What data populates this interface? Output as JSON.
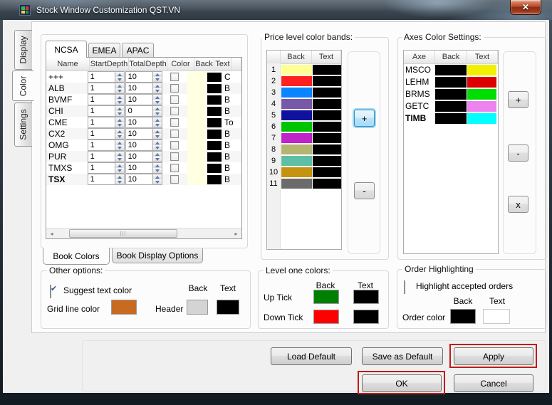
{
  "window": {
    "title": "Stock Window Customization QST.VN",
    "close_glyph": "✕"
  },
  "side_tabs": [
    {
      "label": "Display",
      "selected": false
    },
    {
      "label": "Color",
      "selected": true
    },
    {
      "label": "Settings",
      "selected": false
    }
  ],
  "book": {
    "region_tabs": [
      "NCSA",
      "EMEA",
      "APAC"
    ],
    "selected_region": "NCSA",
    "headers": [
      "Name",
      "StartDepth",
      "TotalDepth",
      "Color",
      "Back",
      "Text"
    ],
    "rows": [
      {
        "name": "+++",
        "start": "1",
        "total": "10",
        "back": "#FFFFE1",
        "text": "#000000",
        "next": "C"
      },
      {
        "name": "ALB",
        "start": "1",
        "total": "10",
        "back": "#FFFFE1",
        "text": "#000000",
        "next": "B"
      },
      {
        "name": "BVMF",
        "start": "1",
        "total": "10",
        "back": "#FFFFE1",
        "text": "#000000",
        "next": "B"
      },
      {
        "name": "CHI",
        "start": "1",
        "total": "0",
        "back": "#FFFFE1",
        "text": "#000000",
        "next": "B"
      },
      {
        "name": "CME",
        "start": "1",
        "total": "10",
        "back": "#FFFFE1",
        "text": "#000000",
        "next": "To"
      },
      {
        "name": "CX2",
        "start": "1",
        "total": "10",
        "back": "#FFFFE1",
        "text": "#000000",
        "next": "B"
      },
      {
        "name": "OMG",
        "start": "1",
        "total": "10",
        "back": "#FFFFE1",
        "text": "#000000",
        "next": "B"
      },
      {
        "name": "PUR",
        "start": "1",
        "total": "10",
        "back": "#FFFFE1",
        "text": "#000000",
        "next": "B"
      },
      {
        "name": "TMXS",
        "start": "1",
        "total": "10",
        "back": "#FFFFE1",
        "text": "#000000",
        "next": "B"
      },
      {
        "name": "TSX",
        "start": "1",
        "total": "10",
        "back": "#FFFFE1",
        "text": "#000000",
        "next": "B",
        "bold": true
      }
    ],
    "bottom_tabs": [
      "Book Colors",
      "Book Display Options"
    ],
    "selected_bottom_tab": "Book Colors"
  },
  "price_bands": {
    "title": "Price level color bands:",
    "headers": [
      "Back",
      "Text"
    ],
    "rows": [
      {
        "n": "1",
        "back": "#FFFF94",
        "text": "#000000"
      },
      {
        "n": "2",
        "back": "#FF2121",
        "text": "#000000"
      },
      {
        "n": "3",
        "back": "#0B84FF",
        "text": "#000000"
      },
      {
        "n": "4",
        "back": "#7859A8",
        "text": "#000000"
      },
      {
        "n": "5",
        "back": "#1111A0",
        "text": "#000000"
      },
      {
        "n": "6",
        "back": "#00C400",
        "text": "#000000"
      },
      {
        "n": "7",
        "back": "#C023C8",
        "text": "#000000"
      },
      {
        "n": "8",
        "back": "#B5B572",
        "text": "#000000"
      },
      {
        "n": "9",
        "back": "#5FBFA5",
        "text": "#000000"
      },
      {
        "n": "10",
        "back": "#C6930E",
        "text": "#000000"
      },
      {
        "n": "11",
        "back": "#6B6B6B",
        "text": "#000000"
      }
    ],
    "buttons": {
      "plus": "+",
      "minus": "-"
    }
  },
  "axes": {
    "title": "Axes Color Settings:",
    "headers": [
      "Axe",
      "Back",
      "Text"
    ],
    "rows": [
      {
        "axe": "MSCO",
        "back": "#000000",
        "text": "#F0F000"
      },
      {
        "axe": "LEHM",
        "back": "#000000",
        "text": "#DD0000"
      },
      {
        "axe": "BRMS",
        "back": "#000000",
        "text": "#00DD00"
      },
      {
        "axe": "GETC",
        "back": "#000000",
        "text": "#EE82EE"
      },
      {
        "axe": "TIMB",
        "back": "#000000",
        "text": "#00FFFF",
        "bold": true
      }
    ],
    "buttons": {
      "plus": "+",
      "minus": "-",
      "close": "x"
    }
  },
  "other_options": {
    "title": "Other options:",
    "suggest_label": "Suggest  text color",
    "suggest_checked": true,
    "grid_line_label": "Grid line color",
    "grid_line_color": "#C96A21",
    "header_label": "Header",
    "back_header": "Back",
    "text_header": "Text",
    "header_back_color": "#D4D4D4",
    "header_text_color": "#000000"
  },
  "level_one": {
    "title": "Level one colors:",
    "back_header": "Back",
    "text_header": "Text",
    "up_label": "Up Tick",
    "up_back": "#008000",
    "up_text": "#000000",
    "down_label": "Down Tick",
    "down_back": "#FF0000",
    "down_text": "#000000"
  },
  "order_highlighting": {
    "title": "Order Highlighting",
    "checkbox_label": "Highlight accepted orders",
    "checked": false,
    "back_header": "Back",
    "text_header": "Text",
    "order_label": "Order color",
    "order_back": "#000000",
    "order_text": "#FFFFFF"
  },
  "footer": {
    "load_default": "Load Default",
    "save_as_default": "Save as Default",
    "apply": "Apply",
    "ok": "OK",
    "cancel": "Cancel"
  },
  "annotation_color": "#C11B17"
}
